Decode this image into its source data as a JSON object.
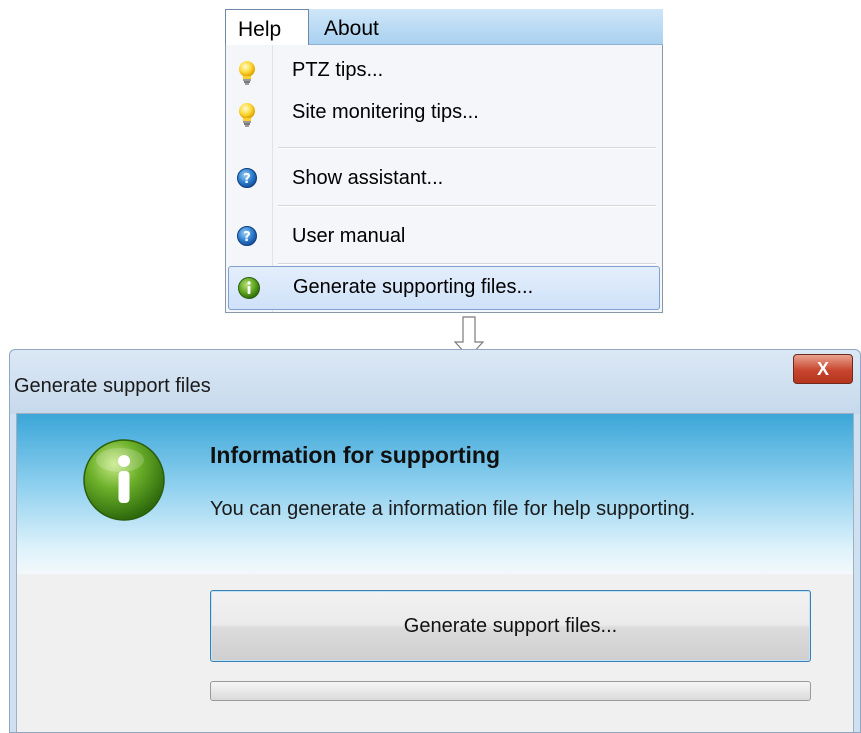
{
  "menu": {
    "bar": {
      "help": "Help",
      "about": "About"
    },
    "items": [
      {
        "label": "PTZ tips...",
        "icon": "lightbulb-icon"
      },
      {
        "label": "Site monitering tips...",
        "icon": "lightbulb-icon"
      },
      {
        "label": "Show assistant...",
        "icon": "help-icon"
      },
      {
        "label": "User manual",
        "icon": "help-icon"
      },
      {
        "label": "Generate supporting files...",
        "icon": "info-icon",
        "selected": true
      }
    ]
  },
  "dialog": {
    "title": "Generate support files",
    "close_label": "X",
    "header_title": "Information for supporting",
    "header_desc": "You can generate a information file for help supporting.",
    "button_label": "Generate support files...",
    "progress_fraction": 0
  },
  "colors": {
    "accent_blue": "#3ba6d8",
    "info_green": "#4e9a1e",
    "close_red": "#c8452e",
    "selection_border": "#7da2ce"
  }
}
